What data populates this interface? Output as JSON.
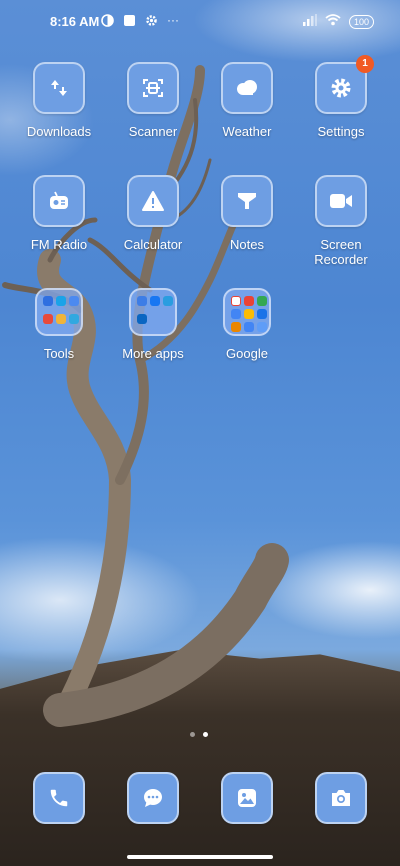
{
  "status_bar": {
    "time": "8:16 AM",
    "left_icons": [
      "vpn-icon",
      "square-icon",
      "gear-icon",
      "more-dots-icon"
    ],
    "more_glyph": "···",
    "right_icons": [
      "signal-icon",
      "wifi-icon"
    ],
    "battery": "100"
  },
  "home": {
    "apps": [
      {
        "label": "Downloads",
        "icon": "downloads-icon"
      },
      {
        "label": "Scanner",
        "icon": "scanner-icon"
      },
      {
        "label": "Weather",
        "icon": "cloud-icon"
      },
      {
        "label": "Settings",
        "icon": "settings-gear-icon",
        "badge": "1"
      },
      {
        "label": "FM Radio",
        "icon": "radio-icon"
      },
      {
        "label": "Calculator",
        "icon": "warning-icon"
      },
      {
        "label": "Notes",
        "icon": "funnel-icon"
      },
      {
        "label": "Screen\nRecorder",
        "icon": "video-camera-icon"
      }
    ],
    "folders": [
      {
        "label": "Tools"
      },
      {
        "label": "More apps"
      },
      {
        "label": "Google"
      }
    ]
  },
  "pager": {
    "pages": 2,
    "active": 2
  },
  "dock": [
    {
      "name": "Phone",
      "icon": "phone-icon"
    },
    {
      "name": "Messages",
      "icon": "chat-bubble-icon"
    },
    {
      "name": "Gallery",
      "icon": "gallery-icon"
    },
    {
      "name": "Camera",
      "icon": "camera-icon"
    }
  ],
  "colors": {
    "tile": "#6e9ee3",
    "badge": "#f15a24",
    "sky": "#4d86d2"
  }
}
